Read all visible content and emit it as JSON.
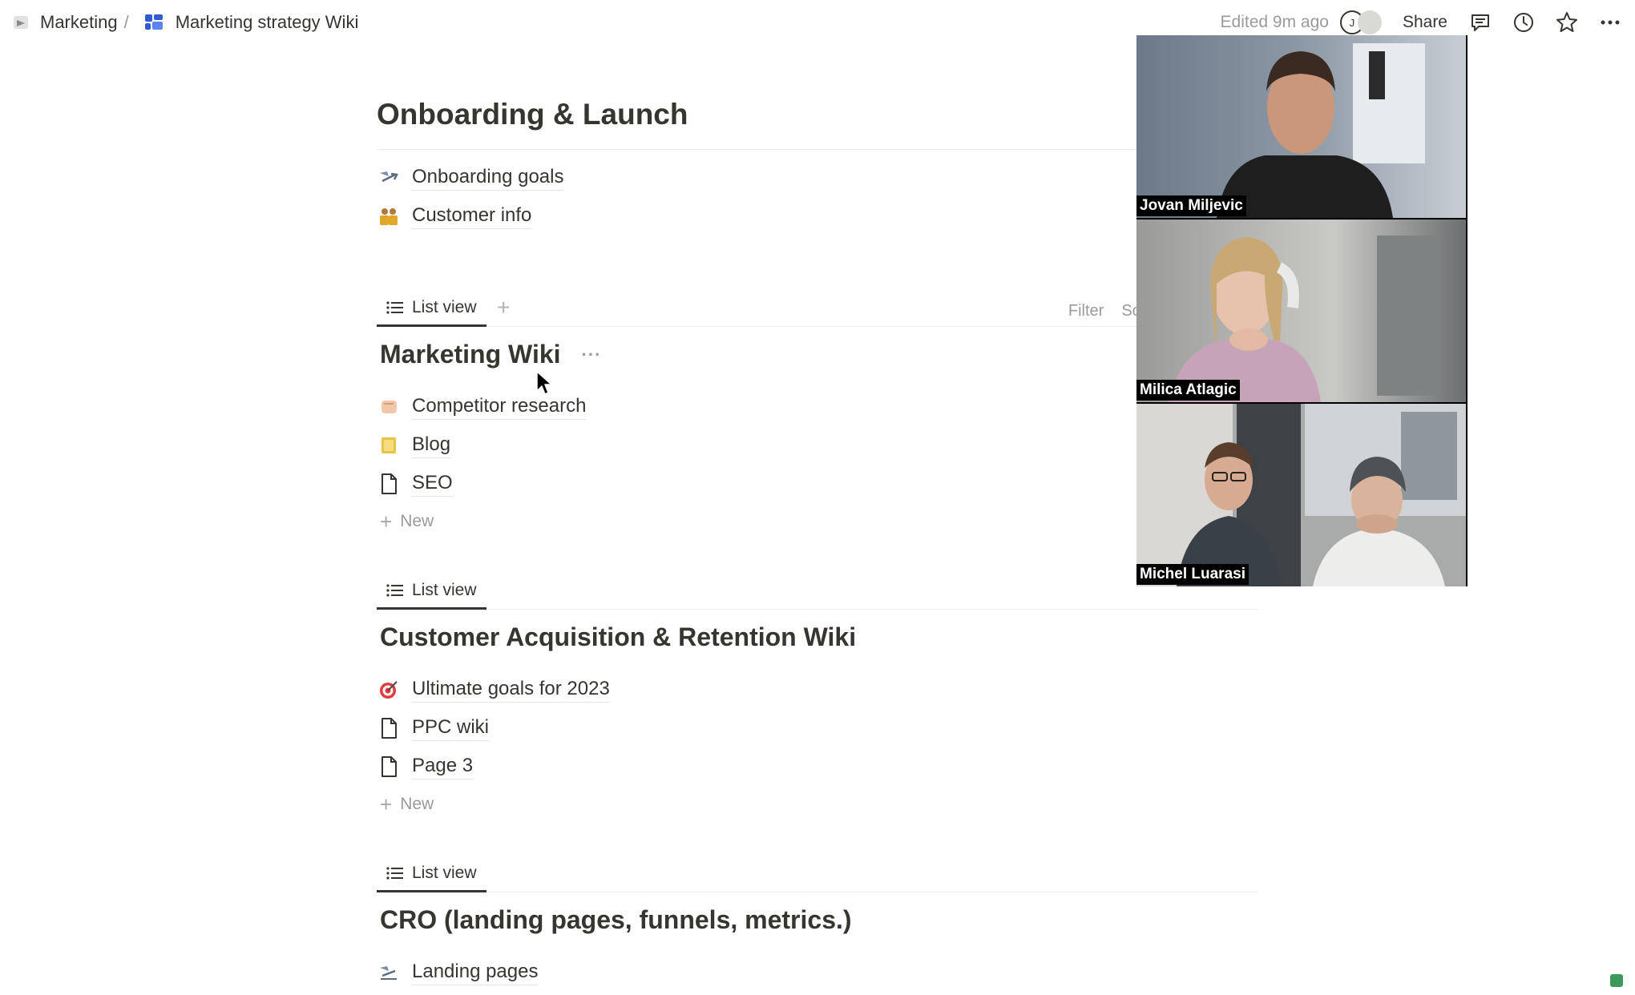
{
  "breadcrumb": {
    "workspace": "Marketing",
    "separator": "/",
    "page": "Marketing strategy Wiki"
  },
  "topbar": {
    "edited": "Edited 9m ago",
    "avatar_initial": "J",
    "share_label": "Share"
  },
  "page": {
    "title": "Onboarding & Launch",
    "items": [
      {
        "icon": "onboarding-icon",
        "label": "Onboarding goals"
      },
      {
        "icon": "customer-icon",
        "label": "Customer info"
      }
    ]
  },
  "databases": [
    {
      "view_label": "List view",
      "title": "Marketing Wiki",
      "items": [
        {
          "icon": "competitor-icon",
          "label": "Competitor research"
        },
        {
          "icon": "blog-icon",
          "label": "Blog"
        },
        {
          "icon": "page-icon",
          "label": "SEO"
        }
      ],
      "new_label": "New",
      "tools": {
        "filter": "Filter",
        "sort": "Sort"
      }
    },
    {
      "view_label": "List view",
      "title": "Customer Acquisition & Retention Wiki",
      "items": [
        {
          "icon": "target-icon",
          "label": "Ultimate goals for 2023"
        },
        {
          "icon": "page-icon",
          "label": "PPC wiki"
        },
        {
          "icon": "page-icon",
          "label": "Page 3"
        }
      ],
      "new_label": "New"
    },
    {
      "view_label": "List view",
      "title": "CRO (landing pages, funnels, metrics.)",
      "items": [
        {
          "icon": "landing-icon",
          "label": "Landing pages"
        }
      ]
    }
  ],
  "video_call": {
    "participants": [
      {
        "name": "Jovan Miljevic"
      },
      {
        "name": "Milica Atlagic"
      },
      {
        "name": "Michel Luarasi"
      }
    ]
  }
}
